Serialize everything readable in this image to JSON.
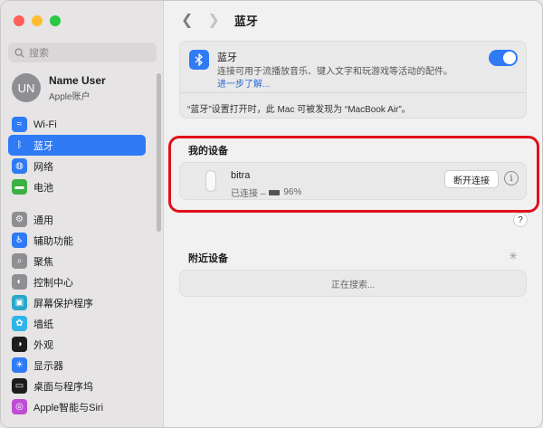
{
  "search": {
    "placeholder": "搜索"
  },
  "account": {
    "initials": "UN",
    "name": "Name User",
    "subtitle": "Apple账户"
  },
  "sidebar": {
    "items": [
      {
        "label": "Wi-Fi",
        "icon": "wifi-icon",
        "color": "#2f7af5",
        "glyph": "≈"
      },
      {
        "label": "蓝牙",
        "icon": "bluetooth-icon",
        "color": "#2f7af5",
        "glyph": "ᛒ"
      },
      {
        "label": "网络",
        "icon": "globe-icon",
        "color": "#2f7af5",
        "glyph": "◍"
      },
      {
        "label": "电池",
        "icon": "battery-icon",
        "color": "#3cb043",
        "glyph": "▬"
      },
      {
        "label": "通用",
        "icon": "gear-icon",
        "color": "#8e8e93",
        "glyph": "⚙"
      },
      {
        "label": "辅助功能",
        "icon": "accessibility-icon",
        "color": "#2f7af5",
        "glyph": "♿"
      },
      {
        "label": "聚焦",
        "icon": "spotlight-icon",
        "color": "#8e8e93",
        "glyph": "⌕"
      },
      {
        "label": "控制中心",
        "icon": "control-center-icon",
        "color": "#8e8e93",
        "glyph": "◐"
      },
      {
        "label": "屏幕保护程序",
        "icon": "screensaver-icon",
        "color": "#2aa7c9",
        "glyph": "▣"
      },
      {
        "label": "墙纸",
        "icon": "wallpaper-icon",
        "color": "#2fb5e8",
        "glyph": "✿"
      },
      {
        "label": "外观",
        "icon": "appearance-icon",
        "color": "#1d1d1f",
        "glyph": "◑"
      },
      {
        "label": "显示器",
        "icon": "display-icon",
        "color": "#2f7af5",
        "glyph": "☀"
      },
      {
        "label": "桌面与程序坞",
        "icon": "dock-icon",
        "color": "#1d1d1f",
        "glyph": "▭"
      },
      {
        "label": "Apple智能与Siri",
        "icon": "siri-icon",
        "color": "#c04bd6",
        "glyph": "◎"
      }
    ]
  },
  "header": {
    "title": "蓝牙"
  },
  "bluetooth": {
    "title": "蓝牙",
    "description": "连接可用于流播放音乐、键入文字和玩游戏等活动的配件。",
    "learn_more": "进一步了解...",
    "enabled": true,
    "note": "“蓝牙”设置打开时，此 Mac 可被发现为 “MacBook Air”。"
  },
  "my_devices": {
    "title": "我的设备",
    "device": {
      "name": "bitra",
      "status": "已连接 –",
      "battery": "96%",
      "disconnect_label": "断开连接"
    }
  },
  "help_label": "?",
  "nearby": {
    "title": "附近设备",
    "searching": "正在搜索..."
  }
}
